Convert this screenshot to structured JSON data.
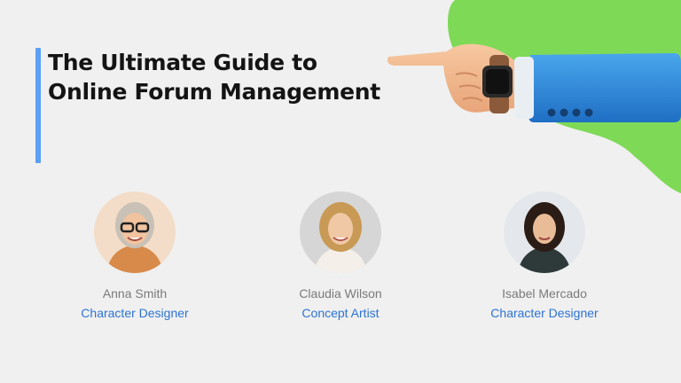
{
  "slide": {
    "title_line1": "The Ultimate Guide to",
    "title_line2": "Online Forum Management",
    "accent_color": "#5aa0f5",
    "blob_color": "#7ed957"
  },
  "team": [
    {
      "name": "Anna Smith",
      "role": "Character Designer",
      "avatar_icon": "person-photo"
    },
    {
      "name": "Claudia Wilson",
      "role": "Concept Artist",
      "avatar_icon": "person-photo"
    },
    {
      "name": "Isabel Mercado",
      "role": "Character Designer",
      "avatar_icon": "person-photo"
    }
  ],
  "decor": {
    "illustration": "pointing-hand-with-smartwatch"
  }
}
